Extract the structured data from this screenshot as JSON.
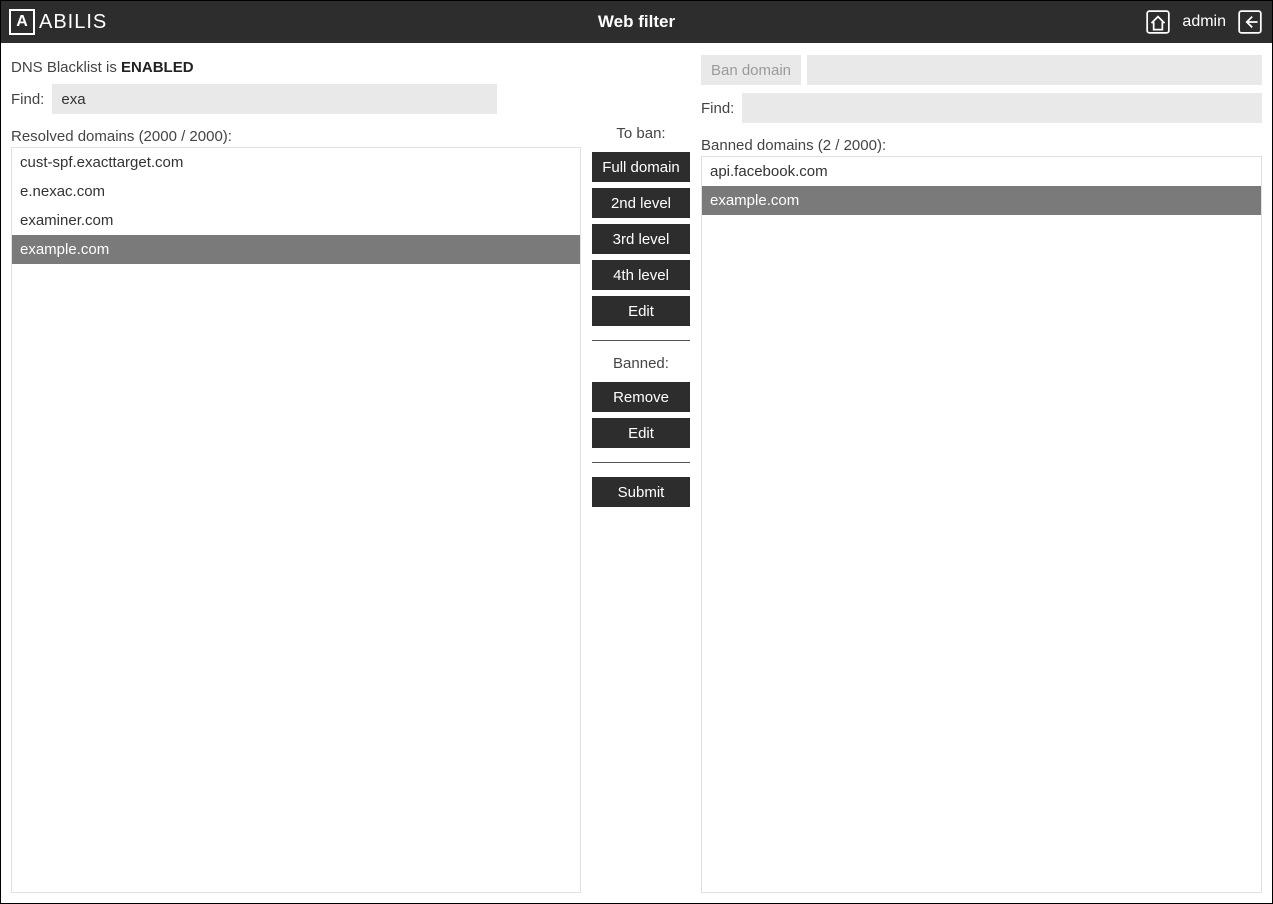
{
  "header": {
    "brand_letter": "A",
    "brand_name": "ABILIS",
    "title": "Web filter",
    "user": "admin"
  },
  "status": {
    "prefix": "DNS Blacklist is ",
    "value": "ENABLED"
  },
  "left": {
    "find_label": "Find:",
    "find_value": "exa",
    "list_label": "Resolved domains (2000 / 2000):",
    "items": [
      {
        "text": "cust-spf.exacttarget.com",
        "selected": false
      },
      {
        "text": "e.nexac.com",
        "selected": false
      },
      {
        "text": "examiner.com",
        "selected": false
      },
      {
        "text": "example.com",
        "selected": true
      }
    ]
  },
  "mid": {
    "to_ban_label": "To ban:",
    "buttons_ban": [
      "Full domain",
      "2nd level",
      "3rd level",
      "4th level",
      "Edit"
    ],
    "banned_label": "Banned:",
    "buttons_banned": [
      "Remove",
      "Edit"
    ],
    "submit": "Submit"
  },
  "right": {
    "ban_button": "Ban domain",
    "ban_value": "",
    "find_label": "Find:",
    "find_value": "",
    "list_label": "Banned domains (2 / 2000):",
    "items": [
      {
        "text": "api.facebook.com",
        "selected": false
      },
      {
        "text": "example.com",
        "selected": true
      }
    ]
  }
}
